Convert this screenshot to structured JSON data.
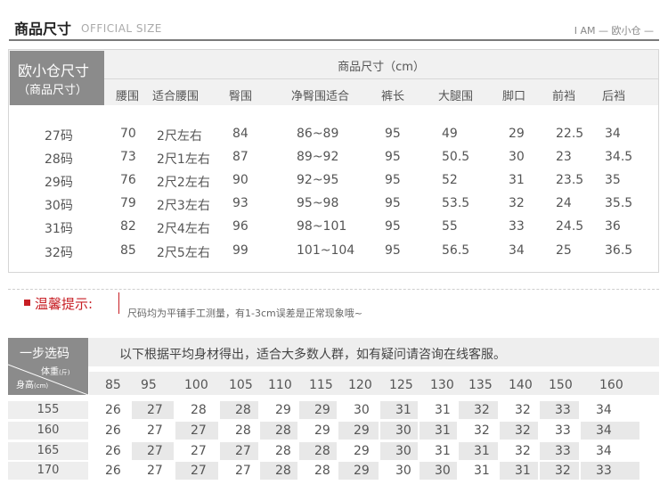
{
  "header": {
    "title": "商品尺寸",
    "subtitle": "OFFICIAL SIZE",
    "right": "I AM — 欧小仓 —"
  },
  "size_table": {
    "corner_line1": "欧小仓尺寸",
    "corner_line2": "（商品尺寸）",
    "center_title": "商品尺寸（cm）",
    "columns": [
      "腰围",
      "适合腰围",
      "臀围",
      "净臀围适合",
      "裤长",
      "大腿围",
      "脚口",
      "前裆",
      "后裆"
    ],
    "rows": [
      [
        "27码",
        "70",
        "2尺左右",
        "84",
        "86~89",
        "95",
        "49",
        "29",
        "22.5",
        "34"
      ],
      [
        "28码",
        "73",
        "2尺1左右",
        "87",
        "89~92",
        "95",
        "50.5",
        "30",
        "23",
        "34.5"
      ],
      [
        "29码",
        "76",
        "2尺2左右",
        "90",
        "92~95",
        "95",
        "52",
        "31",
        "23.5",
        "35"
      ],
      [
        "30码",
        "79",
        "2尺3左右",
        "93",
        "95~98",
        "95",
        "53.5",
        "32",
        "24",
        "35.5"
      ],
      [
        "31码",
        "82",
        "2尺4左右",
        "96",
        "98~101",
        "95",
        "55",
        "33",
        "24.5",
        "36"
      ],
      [
        "32码",
        "85",
        "2尺5左右",
        "99",
        "101~104",
        "95",
        "56.5",
        "34",
        "25",
        "36.5"
      ]
    ]
  },
  "tip": {
    "title": "温馨提示:",
    "text": "尺码均为平铺手工测量，有1-3cm误差是正常现象哦~"
  },
  "fit_table": {
    "corner_title": "一步选码",
    "weight_label": "体重",
    "weight_unit": "(斤)",
    "height_label": "身高",
    "height_unit": "(cm)",
    "heading": "以下根据平均身材得出，适合大多数人群，如有疑问请咨询在线客服。",
    "weights": [
      "85",
      "95",
      "100",
      "105",
      "110",
      "115",
      "120",
      "125",
      "130",
      "135",
      "140",
      "150",
      "160"
    ],
    "heights": [
      "155",
      "160",
      "165",
      "170"
    ],
    "values": [
      [
        "26",
        "27",
        "28",
        "28",
        "29",
        "29",
        "30",
        "31",
        "31",
        "32",
        "32",
        "33",
        "34"
      ],
      [
        "26",
        "27",
        "27",
        "28",
        "28",
        "29",
        "29",
        "30",
        "31",
        "32",
        "32",
        "33",
        "34"
      ],
      [
        "26",
        "27",
        "27",
        "27",
        "28",
        "28",
        "29",
        "30",
        "31",
        "31",
        "32",
        "33",
        "34"
      ],
      [
        "26",
        "27",
        "27",
        "27",
        "28",
        "28",
        "29",
        "30",
        "30",
        "31",
        "31",
        "32",
        "33"
      ]
    ]
  }
}
